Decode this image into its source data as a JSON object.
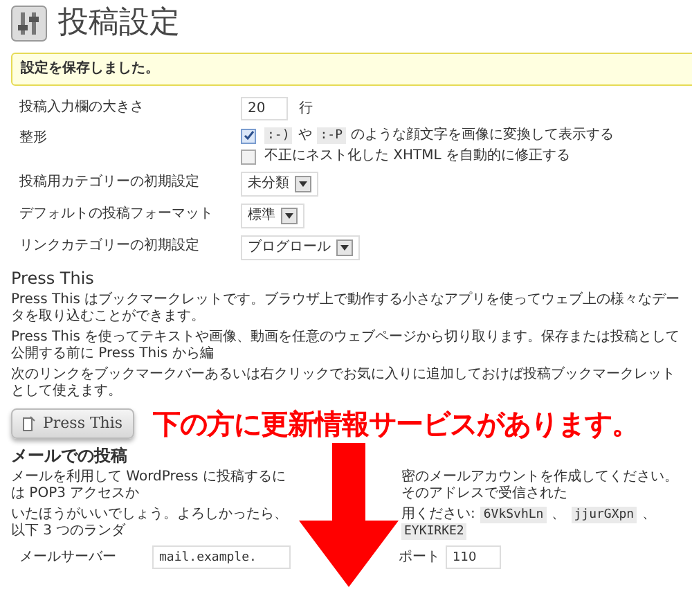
{
  "page": {
    "title": "投稿設定"
  },
  "notice": "設定を保存しました。",
  "settings": [
    {
      "kind": "number",
      "label": "投稿入力欄の大きさ",
      "value": "20",
      "unit": "行"
    },
    {
      "kind": "checks",
      "label": "整形",
      "options": [
        {
          "checked": true,
          "parts": [
            {
              "kind": "code",
              "text": ":-)"
            },
            {
              "kind": "text",
              "text": "や"
            },
            {
              "kind": "code",
              "text": ":-P"
            },
            {
              "kind": "text",
              "text": "のような顔文字を画像に変換して表示する"
            }
          ]
        },
        {
          "checked": false,
          "parts": [
            {
              "kind": "text",
              "text": "不正にネスト化した XHTML を自動的に修正する"
            }
          ]
        }
      ]
    },
    {
      "kind": "select",
      "label": "投稿用カテゴリーの初期設定",
      "value": "未分類"
    },
    {
      "kind": "select",
      "label": "デフォルトの投稿フォーマット",
      "value": "標準"
    },
    {
      "kind": "select",
      "label": "リンクカテゴリーの初期設定",
      "value": "ブログロール"
    }
  ],
  "press_this": {
    "heading": "Press This",
    "paragraphs": [
      "Press This はブックマークレットです。ブラウザ上で動作する小さなアプリを使ってウェブ上の様々なデータを取り込むことができます。",
      "Press This を使ってテキストや画像、動画を任意のウェブページから切り取ります。保存または投稿として公開する前に Press This から編",
      "次のリンクをブックマークバーあるいは右クリックでお気に入りに追加しておけば投稿ブックマークレットとして使えます。"
    ],
    "button": "Press This"
  },
  "annotation": "下の方に更新情報サービスがあります。",
  "mail": {
    "heading": "メールでの投稿",
    "left_lines": [
      "メールを利用して WordPress に投稿するには POP3 アクセスか",
      "いたほうがいいでしょう。よろしかったら、以下 3 つのランダ"
    ],
    "right_lines": [
      [
        {
          "kind": "text",
          "text": "密のメールアカウントを作成してください。そのアドレスで受信された"
        }
      ],
      [
        {
          "kind": "text",
          "text": "用ください:"
        },
        {
          "kind": "code",
          "text": "6VkSvhLn"
        },
        {
          "kind": "text",
          "text": "、"
        },
        {
          "kind": "code",
          "text": "jjurGXpn"
        },
        {
          "kind": "text",
          "text": "、"
        },
        {
          "kind": "code",
          "text": "EYKIRKE2"
        }
      ]
    ],
    "server_label": "メールサーバー",
    "server_value": "mail.example.",
    "port_label": "ポート",
    "port_value": "110"
  }
}
